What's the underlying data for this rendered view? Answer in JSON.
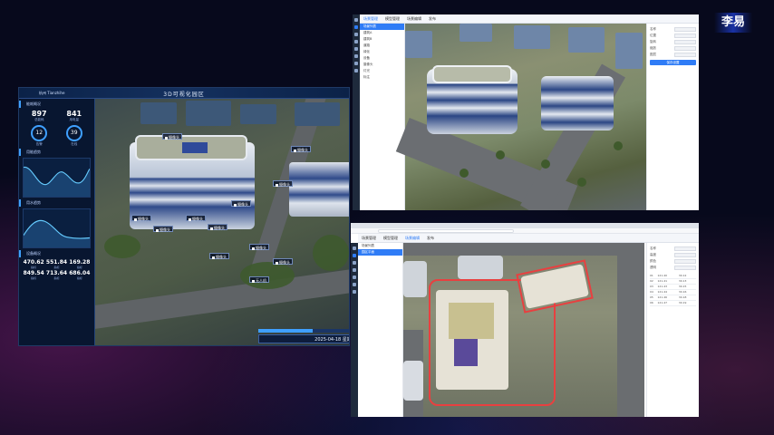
{
  "brand": {
    "name": "李易"
  },
  "dashboard": {
    "location": "杭州 Tianzhihe",
    "title": "3D可视化园区",
    "sections": [
      {
        "title": "能耗概况"
      },
      {
        "title": "用能趋势"
      },
      {
        "title": "用水趋势"
      },
      {
        "title": "设备概况"
      }
    ],
    "stats": [
      {
        "value": "897",
        "label": "总能耗"
      },
      {
        "value": "841",
        "label": "用电量"
      },
      {
        "value": "12",
        "label": "告警"
      },
      {
        "value": "39",
        "label": "在线"
      }
    ],
    "metrics": [
      {
        "value": "470.62",
        "label": "指标"
      },
      {
        "value": "551.84",
        "label": "指标"
      },
      {
        "value": "169.28",
        "label": "指标"
      },
      {
        "value": "849.54",
        "label": "指标"
      },
      {
        "value": "713.64",
        "label": "指标"
      },
      {
        "value": "686.04",
        "label": "指标"
      }
    ],
    "markers": [
      "摄像头",
      "摄像头",
      "摄像头",
      "摄像头",
      "摄像头",
      "摄像头",
      "摄像头",
      "摄像头",
      "摄像头",
      "摄像头",
      "摄像头",
      "无人机"
    ],
    "footer": "2025-04-18 星期五"
  },
  "window_a": {
    "tabs": [
      "场景管理",
      "模型管理",
      "场景编辑",
      "发布"
    ],
    "tree": [
      "场景列表",
      "建筑A",
      "建筑B",
      "道路",
      "绿化",
      "设备",
      "摄像头",
      "灯光",
      "标注"
    ],
    "props": [
      {
        "label": "名称"
      },
      {
        "label": "位置"
      },
      {
        "label": "旋转"
      },
      {
        "label": "缩放"
      },
      {
        "label": "图层"
      }
    ],
    "button": "保存设置"
  },
  "window_b": {
    "tabs": [
      "场景管理",
      "模型管理",
      "场景编辑",
      "发布"
    ],
    "tree": [
      "场景列表",
      "园区平面"
    ],
    "props": [
      {
        "label": "名称"
      },
      {
        "label": "高度"
      },
      {
        "label": "颜色"
      },
      {
        "label": "透明"
      }
    ],
    "table": [
      [
        "01",
        "121.40",
        "30.12"
      ],
      [
        "02",
        "121.41",
        "30.13"
      ],
      [
        "03",
        "121.43",
        "30.15"
      ],
      [
        "04",
        "121.44",
        "30.16"
      ],
      [
        "05",
        "121.46",
        "30.18"
      ],
      [
        "06",
        "121.47",
        "30.19"
      ]
    ]
  }
}
